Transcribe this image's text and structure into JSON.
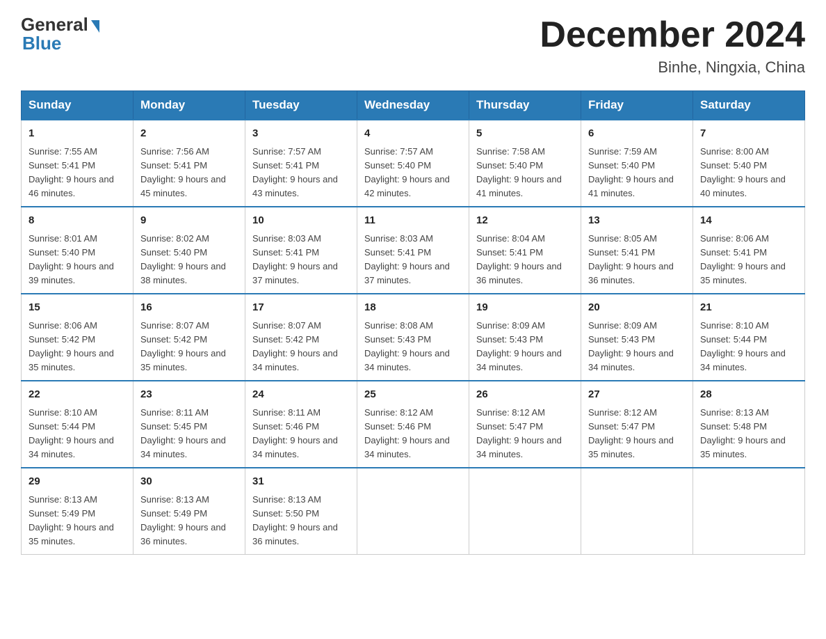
{
  "header": {
    "logo_general": "General",
    "logo_blue": "Blue",
    "month_title": "December 2024",
    "location": "Binhe, Ningxia, China"
  },
  "weekdays": [
    "Sunday",
    "Monday",
    "Tuesday",
    "Wednesday",
    "Thursday",
    "Friday",
    "Saturday"
  ],
  "weeks": [
    [
      {
        "day": "1",
        "sunrise": "7:55 AM",
        "sunset": "5:41 PM",
        "daylight": "9 hours and 46 minutes."
      },
      {
        "day": "2",
        "sunrise": "7:56 AM",
        "sunset": "5:41 PM",
        "daylight": "9 hours and 45 minutes."
      },
      {
        "day": "3",
        "sunrise": "7:57 AM",
        "sunset": "5:41 PM",
        "daylight": "9 hours and 43 minutes."
      },
      {
        "day": "4",
        "sunrise": "7:57 AM",
        "sunset": "5:40 PM",
        "daylight": "9 hours and 42 minutes."
      },
      {
        "day": "5",
        "sunrise": "7:58 AM",
        "sunset": "5:40 PM",
        "daylight": "9 hours and 41 minutes."
      },
      {
        "day": "6",
        "sunrise": "7:59 AM",
        "sunset": "5:40 PM",
        "daylight": "9 hours and 41 minutes."
      },
      {
        "day": "7",
        "sunrise": "8:00 AM",
        "sunset": "5:40 PM",
        "daylight": "9 hours and 40 minutes."
      }
    ],
    [
      {
        "day": "8",
        "sunrise": "8:01 AM",
        "sunset": "5:40 PM",
        "daylight": "9 hours and 39 minutes."
      },
      {
        "day": "9",
        "sunrise": "8:02 AM",
        "sunset": "5:40 PM",
        "daylight": "9 hours and 38 minutes."
      },
      {
        "day": "10",
        "sunrise": "8:03 AM",
        "sunset": "5:41 PM",
        "daylight": "9 hours and 37 minutes."
      },
      {
        "day": "11",
        "sunrise": "8:03 AM",
        "sunset": "5:41 PM",
        "daylight": "9 hours and 37 minutes."
      },
      {
        "day": "12",
        "sunrise": "8:04 AM",
        "sunset": "5:41 PM",
        "daylight": "9 hours and 36 minutes."
      },
      {
        "day": "13",
        "sunrise": "8:05 AM",
        "sunset": "5:41 PM",
        "daylight": "9 hours and 36 minutes."
      },
      {
        "day": "14",
        "sunrise": "8:06 AM",
        "sunset": "5:41 PM",
        "daylight": "9 hours and 35 minutes."
      }
    ],
    [
      {
        "day": "15",
        "sunrise": "8:06 AM",
        "sunset": "5:42 PM",
        "daylight": "9 hours and 35 minutes."
      },
      {
        "day": "16",
        "sunrise": "8:07 AM",
        "sunset": "5:42 PM",
        "daylight": "9 hours and 35 minutes."
      },
      {
        "day": "17",
        "sunrise": "8:07 AM",
        "sunset": "5:42 PM",
        "daylight": "9 hours and 34 minutes."
      },
      {
        "day": "18",
        "sunrise": "8:08 AM",
        "sunset": "5:43 PM",
        "daylight": "9 hours and 34 minutes."
      },
      {
        "day": "19",
        "sunrise": "8:09 AM",
        "sunset": "5:43 PM",
        "daylight": "9 hours and 34 minutes."
      },
      {
        "day": "20",
        "sunrise": "8:09 AM",
        "sunset": "5:43 PM",
        "daylight": "9 hours and 34 minutes."
      },
      {
        "day": "21",
        "sunrise": "8:10 AM",
        "sunset": "5:44 PM",
        "daylight": "9 hours and 34 minutes."
      }
    ],
    [
      {
        "day": "22",
        "sunrise": "8:10 AM",
        "sunset": "5:44 PM",
        "daylight": "9 hours and 34 minutes."
      },
      {
        "day": "23",
        "sunrise": "8:11 AM",
        "sunset": "5:45 PM",
        "daylight": "9 hours and 34 minutes."
      },
      {
        "day": "24",
        "sunrise": "8:11 AM",
        "sunset": "5:46 PM",
        "daylight": "9 hours and 34 minutes."
      },
      {
        "day": "25",
        "sunrise": "8:12 AM",
        "sunset": "5:46 PM",
        "daylight": "9 hours and 34 minutes."
      },
      {
        "day": "26",
        "sunrise": "8:12 AM",
        "sunset": "5:47 PM",
        "daylight": "9 hours and 34 minutes."
      },
      {
        "day": "27",
        "sunrise": "8:12 AM",
        "sunset": "5:47 PM",
        "daylight": "9 hours and 35 minutes."
      },
      {
        "day": "28",
        "sunrise": "8:13 AM",
        "sunset": "5:48 PM",
        "daylight": "9 hours and 35 minutes."
      }
    ],
    [
      {
        "day": "29",
        "sunrise": "8:13 AM",
        "sunset": "5:49 PM",
        "daylight": "9 hours and 35 minutes."
      },
      {
        "day": "30",
        "sunrise": "8:13 AM",
        "sunset": "5:49 PM",
        "daylight": "9 hours and 36 minutes."
      },
      {
        "day": "31",
        "sunrise": "8:13 AM",
        "sunset": "5:50 PM",
        "daylight": "9 hours and 36 minutes."
      },
      null,
      null,
      null,
      null
    ]
  ]
}
